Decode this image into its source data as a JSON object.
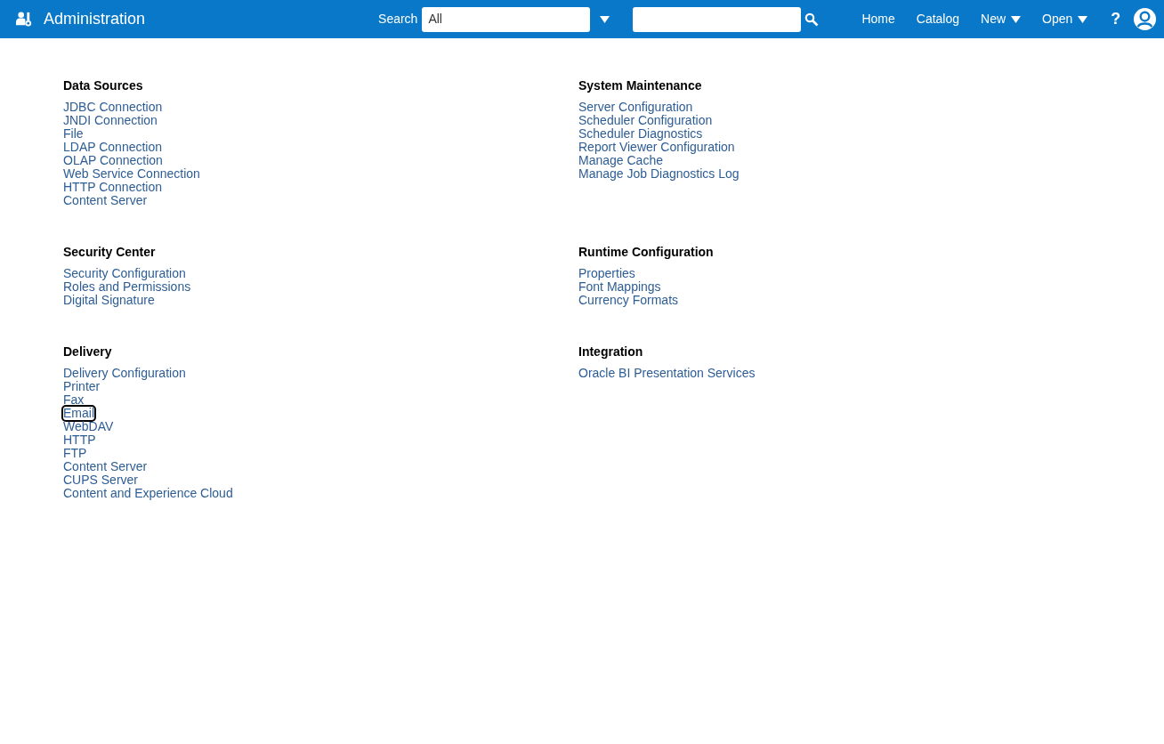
{
  "header": {
    "title": "Administration",
    "search_label": "Search",
    "search_scope": "All",
    "nav": [
      {
        "label": "Home",
        "kind": "link"
      },
      {
        "label": "Catalog",
        "kind": "link"
      },
      {
        "label": "New",
        "kind": "menu"
      },
      {
        "label": "Open",
        "kind": "menu"
      }
    ],
    "help": "?"
  },
  "sections": [
    {
      "title": "Data Sources",
      "links": [
        {
          "label": "JDBC Connection",
          "focused": false
        },
        {
          "label": "JNDI Connection",
          "focused": false
        },
        {
          "label": "File",
          "focused": false
        },
        {
          "label": "LDAP Connection",
          "focused": false
        },
        {
          "label": "OLAP Connection",
          "focused": false
        },
        {
          "label": "Web Service Connection",
          "focused": false
        },
        {
          "label": "HTTP Connection",
          "focused": false
        },
        {
          "label": "Content Server",
          "focused": false
        }
      ]
    },
    {
      "title": "System Maintenance",
      "links": [
        {
          "label": "Server Configuration",
          "focused": false
        },
        {
          "label": "Scheduler Configuration",
          "focused": false
        },
        {
          "label": "Scheduler Diagnostics",
          "focused": false
        },
        {
          "label": "Report Viewer Configuration",
          "focused": false
        },
        {
          "label": "Manage Cache",
          "focused": false
        },
        {
          "label": "Manage Job Diagnostics Log",
          "focused": false
        }
      ]
    },
    {
      "title": "Security Center",
      "links": [
        {
          "label": "Security Configuration",
          "focused": false
        },
        {
          "label": "Roles and Permissions",
          "focused": false
        },
        {
          "label": "Digital Signature",
          "focused": false
        }
      ]
    },
    {
      "title": "Runtime Configuration",
      "links": [
        {
          "label": "Properties",
          "focused": false
        },
        {
          "label": "Font Mappings",
          "focused": false
        },
        {
          "label": "Currency Formats",
          "focused": false
        }
      ]
    },
    {
      "title": "Delivery",
      "links": [
        {
          "label": "Delivery Configuration",
          "focused": false
        },
        {
          "label": "Printer",
          "focused": false
        },
        {
          "label": "Fax",
          "focused": false
        },
        {
          "label": "Email",
          "focused": true
        },
        {
          "label": "WebDAV",
          "focused": false
        },
        {
          "label": "HTTP",
          "focused": false
        },
        {
          "label": "FTP",
          "focused": false
        },
        {
          "label": "Content Server",
          "focused": false
        },
        {
          "label": "CUPS Server",
          "focused": false
        },
        {
          "label": "Content and Experience Cloud",
          "focused": false
        }
      ]
    },
    {
      "title": "Integration",
      "links": [
        {
          "label": "Oracle BI Presentation Services",
          "focused": false
        }
      ]
    }
  ]
}
